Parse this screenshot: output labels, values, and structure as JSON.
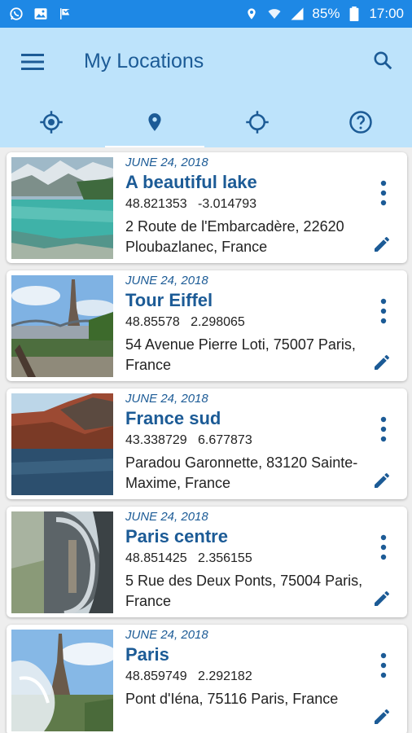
{
  "status_bar": {
    "battery": "85%",
    "time": "17:00",
    "left_icons": [
      "whatsapp-icon",
      "gallery-icon",
      "flag-icon"
    ],
    "right_icons": [
      "location-icon",
      "wifi-icon",
      "signal-icon",
      "battery-icon"
    ]
  },
  "header": {
    "title": "My Locations",
    "menu_icon": "menu-icon",
    "search_icon": "search-icon"
  },
  "tabs": [
    {
      "icon": "my-location-icon",
      "active": false
    },
    {
      "icon": "place-pin-icon",
      "active": true
    },
    {
      "icon": "crosshair-icon",
      "active": false
    },
    {
      "icon": "help-icon",
      "active": false
    }
  ],
  "locations": [
    {
      "date": "JUNE 24, 2018",
      "name": "A beautiful lake",
      "lat": "48.821353",
      "lon": "-3.014793",
      "address": "2 Route de l'Embarcadère, 22620 Ploubazlanec, France"
    },
    {
      "date": "JUNE 24, 2018",
      "name": "Tour Eiffel",
      "lat": "48.85578",
      "lon": "2.298065",
      "address": "54 Avenue Pierre Loti, 75007 Paris, France"
    },
    {
      "date": "JUNE 24, 2018",
      "name": "France sud",
      "lat": "43.338729",
      "lon": "6.677873",
      "address": "Paradou Garonnette, 83120 Sainte-Maxime, France"
    },
    {
      "date": "JUNE 24, 2018",
      "name": "Paris centre",
      "lat": "48.851425",
      "lon": "2.356155",
      "address": "5 Rue des Deux Ponts, 75004 Paris, France"
    },
    {
      "date": "JUNE 24, 2018",
      "name": "Paris",
      "lat": "48.859749",
      "lon": "2.292182",
      "address": "Pont d'Iéna, 75116 Paris, France"
    }
  ],
  "colors": {
    "status_bar": "#1e88e5",
    "app_bar": "#bde3fb",
    "accent": "#1c5b96"
  }
}
